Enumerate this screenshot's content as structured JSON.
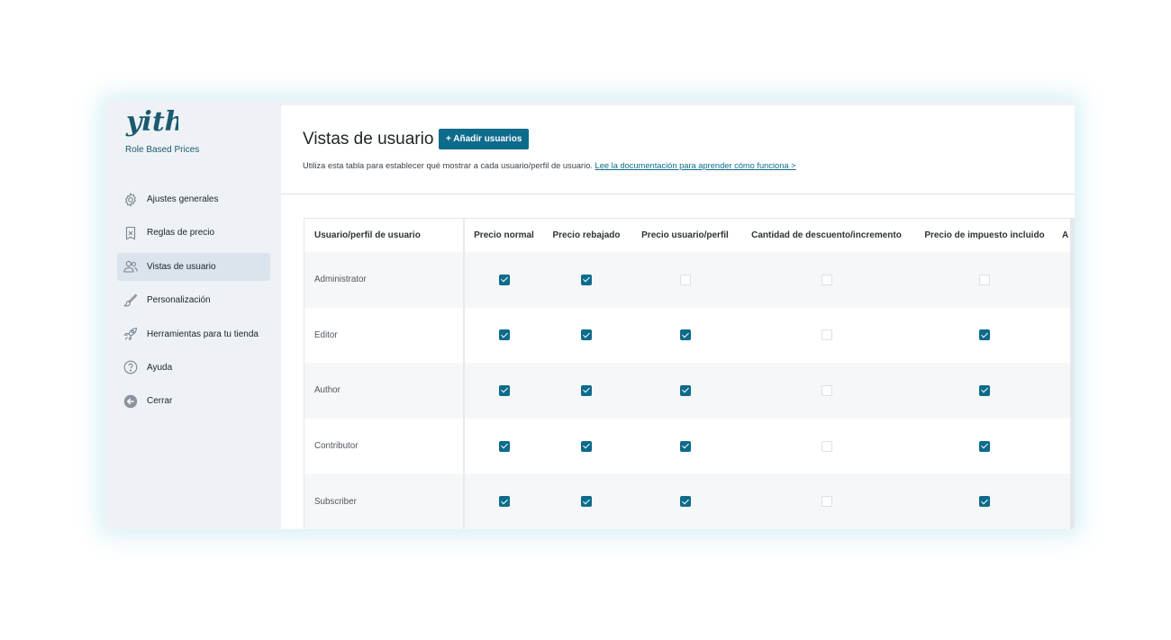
{
  "sidebar": {
    "plugin_name": "Role Based Prices",
    "items": [
      {
        "label": "Ajustes generales",
        "icon": "gear-icon"
      },
      {
        "label": "Reglas de precio",
        "icon": "price-tag-icon"
      },
      {
        "label": "Vistas de usuario",
        "icon": "users-icon",
        "active": true
      },
      {
        "label": "Personalización",
        "icon": "brush-icon"
      },
      {
        "label": "Herramientas para tu tienda",
        "icon": "rocket-icon"
      },
      {
        "label": "Ayuda",
        "icon": "help-icon"
      },
      {
        "label": "Cerrar",
        "icon": "arrow-left-circle-icon"
      }
    ]
  },
  "header": {
    "title": "Vistas de usuario",
    "add_button": "+ Añadir usuarios",
    "description": "Utiliza esta tabla para establecer qué mostrar a cada usuario/perfil de usuario.",
    "doc_link": "Lee la documentación para aprender cómo funciona >"
  },
  "table": {
    "columns": [
      "Usuario/perfil de usuario",
      "Precio normal",
      "Precio rebajado",
      "Precio usuario/perfil",
      "Cantidad de descuento/incremento",
      "Precio de impuesto incluido",
      "A"
    ],
    "rows": [
      {
        "role": "Administrator",
        "checks": [
          true,
          true,
          false,
          false,
          false
        ]
      },
      {
        "role": "Editor",
        "checks": [
          true,
          true,
          true,
          false,
          true
        ]
      },
      {
        "role": "Author",
        "checks": [
          true,
          true,
          true,
          false,
          true
        ]
      },
      {
        "role": "Contributor",
        "checks": [
          true,
          true,
          true,
          false,
          true
        ]
      },
      {
        "role": "Subscriber",
        "checks": [
          true,
          true,
          true,
          false,
          true
        ]
      }
    ]
  },
  "colors": {
    "accent": "#0d6b8c",
    "sidebar_bg": "#eef2f7",
    "active_bg": "#dbe3ed"
  }
}
